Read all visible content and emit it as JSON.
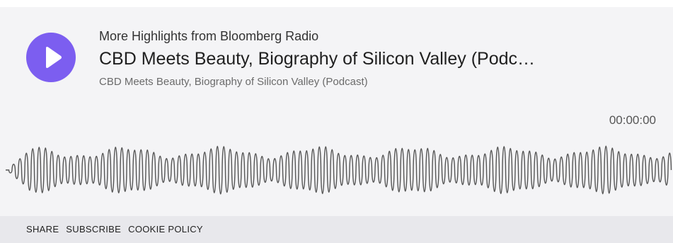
{
  "player": {
    "series_title": "More Highlights from Bloomberg Radio",
    "episode_title": "CBD Meets Beauty, Biography of Silicon Valley (Podc…",
    "episode_subtitle": "CBD Meets Beauty, Biography of Silicon Valley (Podcast)",
    "time": "00:00:00",
    "play_icon": "play-icon",
    "accent_color": "#7c5ef0"
  },
  "footer": {
    "share": "SHARE",
    "subscribe": "SUBSCRIBE",
    "cookie_policy": "COOKIE POLICY"
  }
}
